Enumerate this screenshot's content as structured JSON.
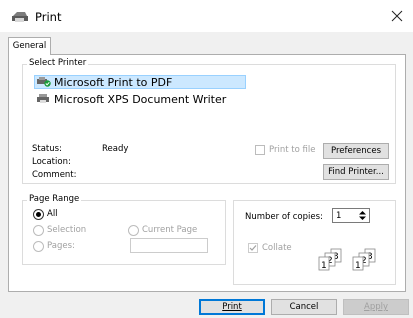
{
  "window": {
    "title": "Print",
    "title_icon": "printer-icon",
    "close_icon": "close-icon"
  },
  "tabs": [
    {
      "label": "General",
      "selected": true
    }
  ],
  "select_printer": {
    "legend": "Select Printer",
    "printers": [
      {
        "name": "Microsoft Print to PDF",
        "selected": true,
        "icon": "printer-default-icon"
      },
      {
        "name": "Microsoft XPS Document Writer",
        "selected": false,
        "icon": "printer-icon"
      }
    ],
    "status_label": "Status:",
    "status_value": "Ready",
    "location_label": "Location:",
    "location_value": "",
    "comment_label": "Comment:",
    "comment_value": "",
    "print_to_file_label": "Print to file",
    "print_to_file_checked": false,
    "preferences_label": "Preferences",
    "find_printer_label": "Find Printer..."
  },
  "page_range": {
    "legend": "Page Range",
    "options": [
      {
        "label": "All",
        "selected": true,
        "enabled": true
      },
      {
        "label": "Selection",
        "selected": false,
        "enabled": false
      },
      {
        "label": "Current Page",
        "selected": false,
        "enabled": false
      },
      {
        "label": "Pages:",
        "selected": false,
        "enabled": false
      }
    ],
    "pages_value": ""
  },
  "copies": {
    "label": "Number of copies:",
    "value": "1",
    "collate_label": "Collate",
    "collate_checked": true,
    "collate_enabled": false
  },
  "buttons": {
    "print": "Print",
    "cancel": "Cancel",
    "apply": "Apply"
  },
  "colors": {
    "selection_bg": "#cce8ff",
    "accent": "#0078d7",
    "dialog_bg": "#f0f0f0"
  }
}
